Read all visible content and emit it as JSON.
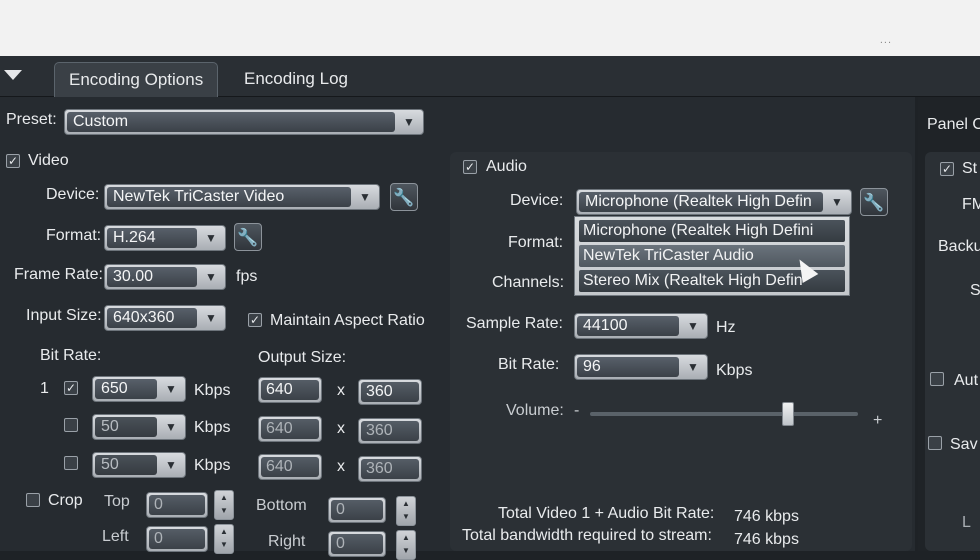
{
  "tabs": [
    "Encoding Options",
    "Encoding Log"
  ],
  "dots": "...",
  "preset": {
    "label": "Preset:",
    "value": "Custom"
  },
  "right_panel": {
    "title": "Panel O",
    "items": [
      "St",
      "FM",
      "Backu",
      "S",
      "Aut",
      "Sav",
      "L"
    ]
  },
  "video": {
    "section": "Video",
    "device_label": "Device:",
    "device_value": "NewTek TriCaster Video",
    "format_label": "Format:",
    "format_value": "H.264",
    "frame_rate_label": "Frame Rate:",
    "frame_rate_value": "30.00",
    "frame_rate_unit": "fps",
    "input_size_label": "Input Size:",
    "input_size_value": "640x360",
    "maintain_aspect_label": "Maintain Aspect Ratio",
    "bit_rate_label": "Bit Rate:",
    "output_size_label": "Output Size:",
    "rows": [
      {
        "index": "1",
        "bitrate": "650",
        "unit": "Kbps",
        "w": "640",
        "x": "x",
        "h": "360"
      },
      {
        "index": "",
        "bitrate": "50",
        "unit": "Kbps",
        "w": "640",
        "x": "x",
        "h": "360"
      },
      {
        "index": "",
        "bitrate": "50",
        "unit": "Kbps",
        "w": "640",
        "x": "x",
        "h": "360"
      }
    ],
    "crop_label": "Crop",
    "top_label": "Top",
    "top_value": "0",
    "bottom_label": "Bottom",
    "bottom_value": "0",
    "left_label": "Left",
    "left_value": "0",
    "right_label": "Right",
    "right_value": "0"
  },
  "audio": {
    "section": "Audio",
    "device_label": "Device:",
    "device_value": "Microphone (Realtek High Defin",
    "dropdown_options": [
      "Microphone (Realtek High Defini",
      "NewTek TriCaster Audio",
      "Stereo Mix (Realtek High Defin"
    ],
    "format_label": "Format:",
    "channels_label": "Channels:",
    "sample_rate_label": "Sample Rate:",
    "sample_rate_value": "44100",
    "sample_rate_unit": "Hz",
    "bit_rate_label": "Bit Rate:",
    "bit_rate_value": "96",
    "bit_rate_unit": "Kbps",
    "volume_label": "Volume:",
    "volume_minus": "-",
    "volume_plus": "+",
    "volume_level": 0.74
  },
  "totals": {
    "video_audio_label": "Total Video 1 + Audio Bit Rate:",
    "video_audio_value": "746 kbps",
    "bandwidth_label": "Total bandwidth required to stream:",
    "bandwidth_value": "746 kbps"
  },
  "icons": {
    "wrench": "wrench-icon",
    "check": "✓",
    "arrow": "▼"
  }
}
